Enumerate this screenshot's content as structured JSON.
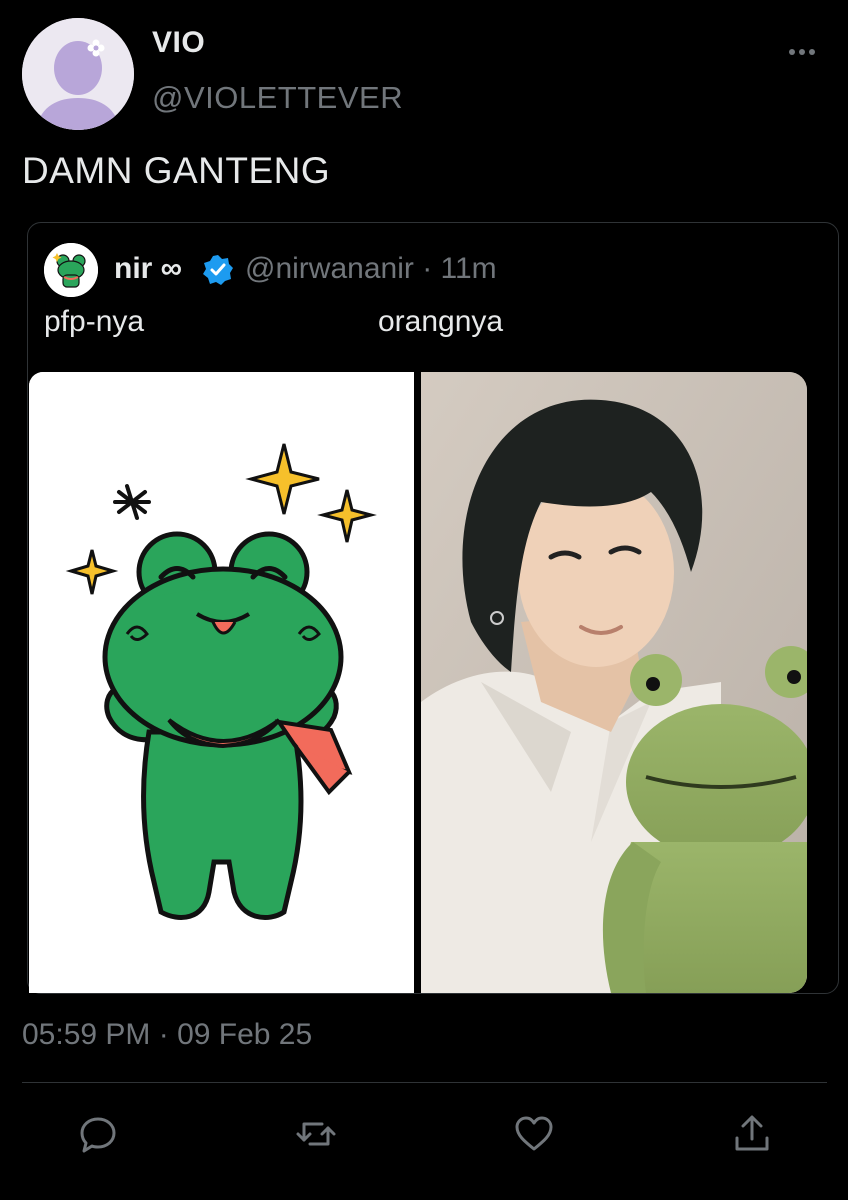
{
  "tweet": {
    "author": {
      "display_name": "VIO",
      "handle": "@VIOLETTEVER",
      "avatar_icon": "default-avatar-icon"
    },
    "text": "DAMN GANTENG",
    "timestamp": "05:59 PM · 09 Feb 25",
    "more_icon": "more-options-icon"
  },
  "quote": {
    "author": {
      "display_name": "nir ∞",
      "handle": "@nirwananir · 11m",
      "verified": true,
      "avatar_icon": "frog-avatar-icon"
    },
    "text_left": "pfp-nya",
    "text_right": "orangnya",
    "media": [
      {
        "name": "frog-illustration-image"
      },
      {
        "name": "selfie-with-frog-plush-image"
      }
    ]
  },
  "actions": [
    {
      "name": "reply-button",
      "icon": "reply-icon"
    },
    {
      "name": "retweet-button",
      "icon": "retweet-icon"
    },
    {
      "name": "like-button",
      "icon": "heart-icon"
    },
    {
      "name": "share-button",
      "icon": "share-icon"
    }
  ],
  "colors": {
    "background": "#000000",
    "text": "#e7e9ea",
    "secondary_text": "#71767b",
    "border": "#2f3336",
    "verified": "#1d9bf0",
    "frog_green": "#2aa55b",
    "scarf": "#f26b5b",
    "avatar_lilac": "#b8a6d9"
  }
}
